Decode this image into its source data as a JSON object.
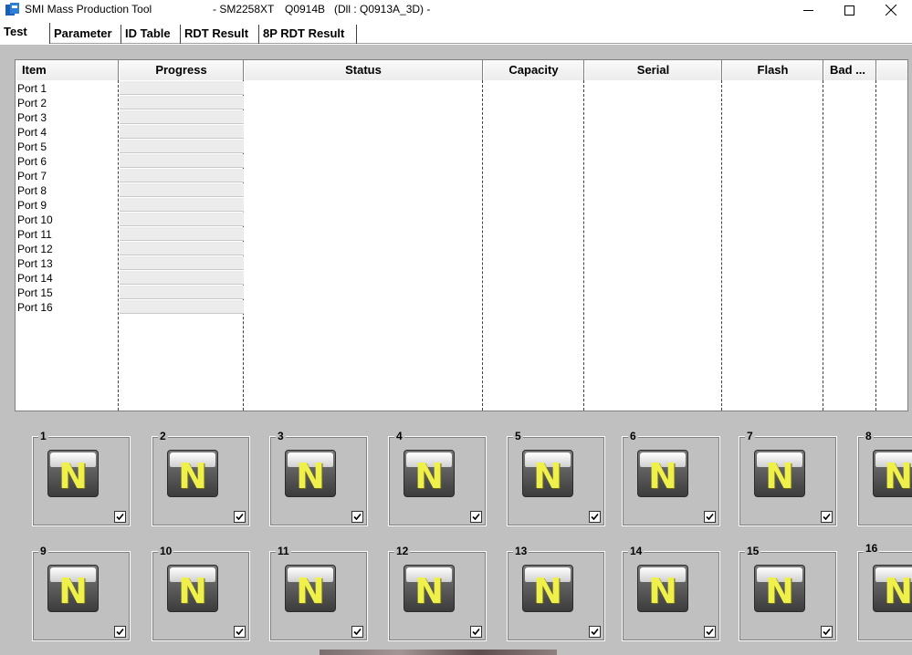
{
  "window": {
    "title": "SMI Mass Production Tool",
    "model": "- SM2258XT",
    "version": "Q0914B",
    "dll": "(Dll : Q0913A_3D) -",
    "controls": {
      "minimize": "—",
      "maximize": "☐",
      "close": "✕"
    }
  },
  "tabs": [
    "Test",
    "Parameter",
    "ID Table",
    "RDT Result",
    "8P RDT Result"
  ],
  "listview": {
    "columns": [
      "Item",
      "Progress",
      "Status",
      "Capacity",
      "Serial",
      "Flash",
      "Bad ..."
    ],
    "rows": [
      "Port 1",
      "Port 2",
      "Port 3",
      "Port 4",
      "Port 5",
      "Port 6",
      "Port 7",
      "Port 8",
      "Port 9",
      "Port 10",
      "Port 11",
      "Port 12",
      "Port 13",
      "Port 14",
      "Port 15",
      "Port 16"
    ]
  },
  "ports": [
    {
      "num": "1",
      "letter": "N",
      "checked": true
    },
    {
      "num": "2",
      "letter": "N",
      "checked": true
    },
    {
      "num": "3",
      "letter": "N",
      "checked": true
    },
    {
      "num": "4",
      "letter": "N",
      "checked": true
    },
    {
      "num": "5",
      "letter": "N",
      "checked": true
    },
    {
      "num": "6",
      "letter": "N",
      "checked": true
    },
    {
      "num": "7",
      "letter": "N",
      "checked": true
    },
    {
      "num": "8",
      "letter": "N",
      "checked": true
    },
    {
      "num": "9",
      "letter": "N",
      "checked": true
    },
    {
      "num": "10",
      "letter": "N",
      "checked": true
    },
    {
      "num": "11",
      "letter": "N",
      "checked": true
    },
    {
      "num": "12",
      "letter": "N",
      "checked": true
    },
    {
      "num": "13",
      "letter": "N",
      "checked": true
    },
    {
      "num": "14",
      "letter": "N",
      "checked": true
    },
    {
      "num": "15",
      "letter": "N",
      "checked": true
    },
    {
      "num": "16",
      "letter": "N",
      "checked": true
    }
  ],
  "colors": {
    "background": "#c0c0c0",
    "n_letter": "#f0f04a"
  }
}
